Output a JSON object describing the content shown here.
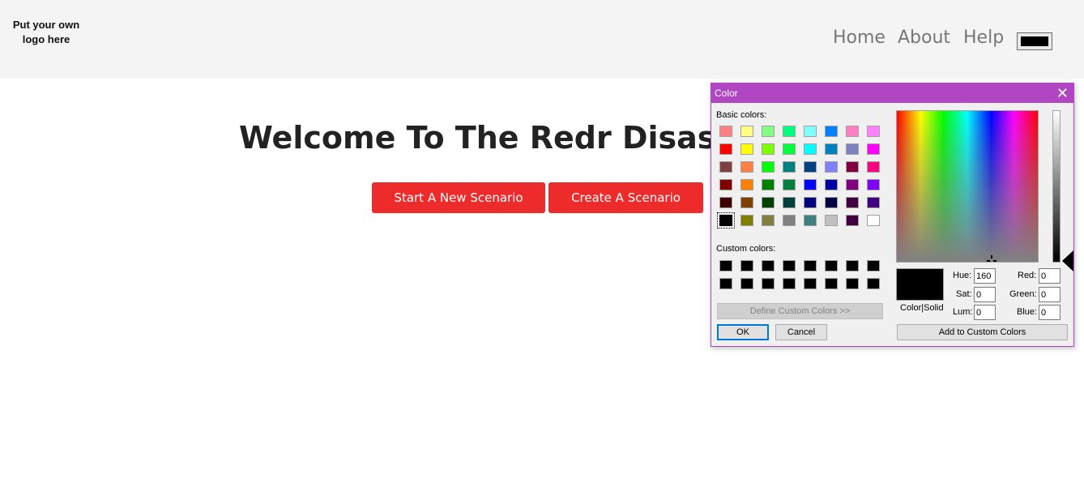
{
  "header": {
    "logo_text": "Put your own logo here",
    "nav": [
      "Home",
      "About",
      "Help"
    ],
    "color_value": "#000000"
  },
  "main": {
    "title": "Welcome To The Redr Disaster S",
    "buttons": [
      "Start A New Scenario",
      "Create A Scenario"
    ],
    "button_color": "#ee2b2b"
  },
  "dialog": {
    "title": "Color",
    "basic_colors_label": "Basic colors:",
    "custom_colors_label": "Custom colors:",
    "define_custom_label": "Define Custom Colors >>",
    "ok_label": "OK",
    "cancel_label": "Cancel",
    "color_solid_label": "Color|Solid",
    "add_custom_label": "Add to Custom Colors",
    "fields": {
      "hue_label": "Hue:",
      "hue": "160",
      "sat_label": "Sat:",
      "sat": "0",
      "lum_label": "Lum:",
      "lum": "0",
      "red_label": "Red:",
      "red": "0",
      "green_label": "Green:",
      "green": "0",
      "blue_label": "Blue:",
      "blue": "0"
    },
    "basic_colors": [
      [
        "#ff8080",
        "#ffff80",
        "#80ff80",
        "#00ff80",
        "#80ffff",
        "#0080ff",
        "#ff80c0",
        "#ff80ff"
      ],
      [
        "#ff0000",
        "#ffff00",
        "#80ff00",
        "#00ff40",
        "#00ffff",
        "#0080c0",
        "#8080c0",
        "#ff00ff"
      ],
      [
        "#804040",
        "#ff8040",
        "#00ff00",
        "#008080",
        "#004080",
        "#8080ff",
        "#800040",
        "#ff0080"
      ],
      [
        "#800000",
        "#ff8000",
        "#008000",
        "#008040",
        "#0000ff",
        "#0000a0",
        "#800080",
        "#8000ff"
      ],
      [
        "#400000",
        "#804000",
        "#004000",
        "#004040",
        "#000080",
        "#000040",
        "#400040",
        "#400080"
      ],
      [
        "#000000",
        "#808000",
        "#808040",
        "#808080",
        "#408080",
        "#c0c0c0",
        "#400040",
        "#ffffff"
      ]
    ],
    "selected_basic": "#000000",
    "custom_colors": [
      [
        "#000000",
        "#000000",
        "#000000",
        "#000000",
        "#000000",
        "#000000",
        "#000000",
        "#000000"
      ],
      [
        "#000000",
        "#000000",
        "#000000",
        "#000000",
        "#000000",
        "#000000",
        "#000000",
        "#000000"
      ]
    ],
    "accent_color": "#b146c2"
  }
}
